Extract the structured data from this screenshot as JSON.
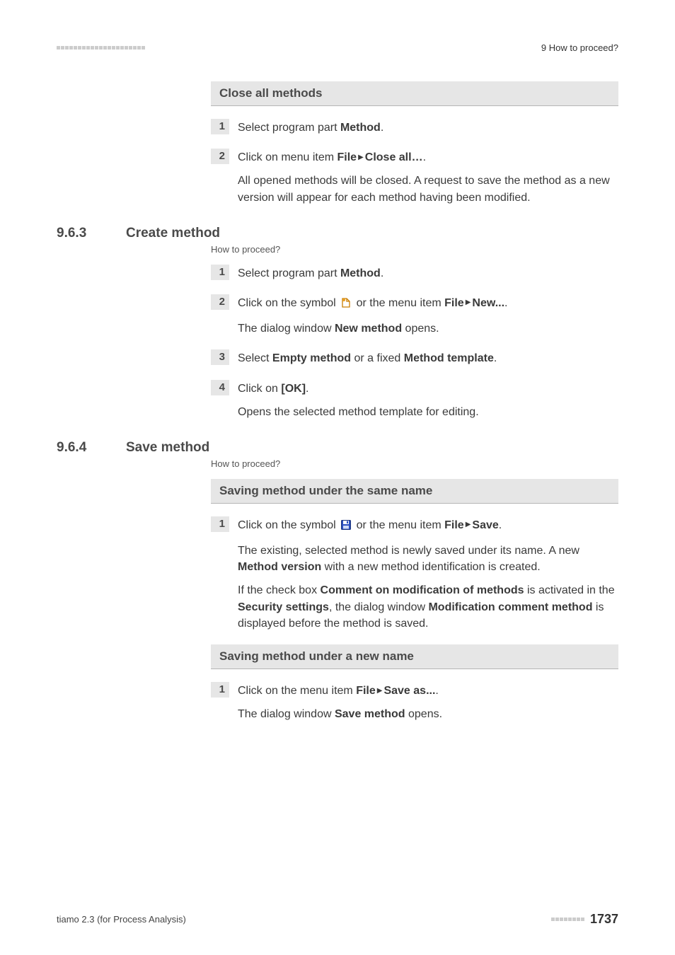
{
  "header": {
    "chapter": "9 How to proceed?"
  },
  "close_all": {
    "band_title": "Close all methods",
    "step1_a": "Select program part ",
    "step1_b": "Method",
    "step1_c": ".",
    "step2_a": "Click on menu item ",
    "step2_b": "File",
    "step2_c": "Close all…",
    "step2_d": ".",
    "step2_body": "All opened methods will be closed. A request to save the method as a new version will appear for each method having been modified."
  },
  "sec963": {
    "num": "9.6.3",
    "title": "Create method",
    "howto": "How to proceed?",
    "step1_a": "Select program part ",
    "step1_b": "Method",
    "step1_c": ".",
    "step2_a": "Click on the symbol ",
    "step2_b": " or the menu item ",
    "step2_c": "File",
    "step2_d": "New...",
    "step2_e": ".",
    "step2_body_a": "The dialog window ",
    "step2_body_b": "New method",
    "step2_body_c": " opens.",
    "step3_a": "Select ",
    "step3_b": "Empty method",
    "step3_c": " or a fixed ",
    "step3_d": "Method template",
    "step3_e": ".",
    "step4_a": "Click on ",
    "step4_b": "[OK]",
    "step4_c": ".",
    "step4_body": "Opens the selected method template for editing."
  },
  "sec964": {
    "num": "9.6.4",
    "title": "Save method",
    "howto": "How to proceed?",
    "band1": "Saving method under the same name",
    "s1_a": "Click on the symbol ",
    "s1_b": " or the menu item ",
    "s1_c": "File",
    "s1_d": "Save",
    "s1_e": ".",
    "s1_p2_a": "The existing, selected method is newly saved under its name. A new ",
    "s1_p2_b": "Method version",
    "s1_p2_c": " with a new method identification is created.",
    "s1_p3_a": "If the check box ",
    "s1_p3_b": "Comment on modification of methods",
    "s1_p3_c": " is activated in the ",
    "s1_p3_d": "Security settings",
    "s1_p3_e": ", the dialog window ",
    "s1_p3_f": "Modification comment method",
    "s1_p3_g": " is displayed before the method is saved.",
    "band2": "Saving method under a new name",
    "b2_s1_a": "Click on the menu item ",
    "b2_s1_b": "File",
    "b2_s1_c": "Save as...",
    "b2_s1_d": ".",
    "b2_s1_p2_a": "The dialog window ",
    "b2_s1_p2_b": "Save method",
    "b2_s1_p2_c": " opens."
  },
  "footer": {
    "left": "tiamo 2.3 (for Process Analysis)",
    "page": "1737"
  },
  "nums": {
    "n1": "1",
    "n2": "2",
    "n3": "3",
    "n4": "4"
  }
}
